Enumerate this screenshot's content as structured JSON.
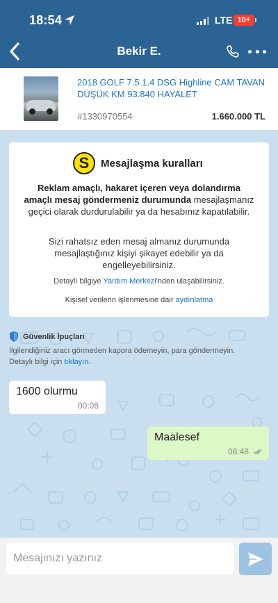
{
  "status_bar": {
    "time": "18:54",
    "network": "LTE",
    "battery": "10+"
  },
  "header": {
    "title": "Bekir E."
  },
  "listing": {
    "title": "2018 GOLF 7.5 1.4 DSG Highline CAM TAVAN DÜŞÜK KM 93.840 HAYALET",
    "id": "#1330970554",
    "price": "1.660.000 TL"
  },
  "rules": {
    "logo_letter": "S",
    "heading": "Mesajlaşma kuralları",
    "p1_bold": "Reklam amaçlı, hakaret içeren veya dolandırma amaçlı mesaj göndermeniz durumunda",
    "p1_rest": "mesajlaşmanız geçici olarak durdurulabilir ya da hesabınız kapatılabilir.",
    "p2": "Sizi rahatsız eden mesaj almanız durumunda mesajlaştığınız kişiyi şikayet edebilir ya da engelleyebilirsiniz.",
    "p3_prefix": "Detaylı bilgiye",
    "p3_link": "Yardım Merkezi",
    "p3_suffix": "'nden ulaşabilirsiniz.",
    "p4_prefix": "Kişisel verilerin işlenmesine dair",
    "p4_link": "aydınlatma"
  },
  "tips": {
    "title": "Güvenlik İpuçları",
    "text": "İlgilendiğiniz aracı görmeden kapora ödemeyin, para göndermeyin.",
    "detail_prefix": "Detaylı bilgi için",
    "detail_link": "tıklayın",
    "detail_suffix": "."
  },
  "messages": [
    {
      "direction": "in",
      "text": "1600 olurmu",
      "time": "00:08"
    },
    {
      "direction": "out",
      "text": "Maalesef",
      "time": "08:48"
    }
  ],
  "composer": {
    "placeholder": "Mesajınızı yazınız"
  },
  "colors": {
    "header_bg": "#2b6494",
    "chat_bg": "#c9dff0",
    "link": "#1a73c4",
    "outgoing_bubble": "#dcf8c6",
    "logo_yellow": "#fde400",
    "send_button": "#9ec3e2"
  }
}
